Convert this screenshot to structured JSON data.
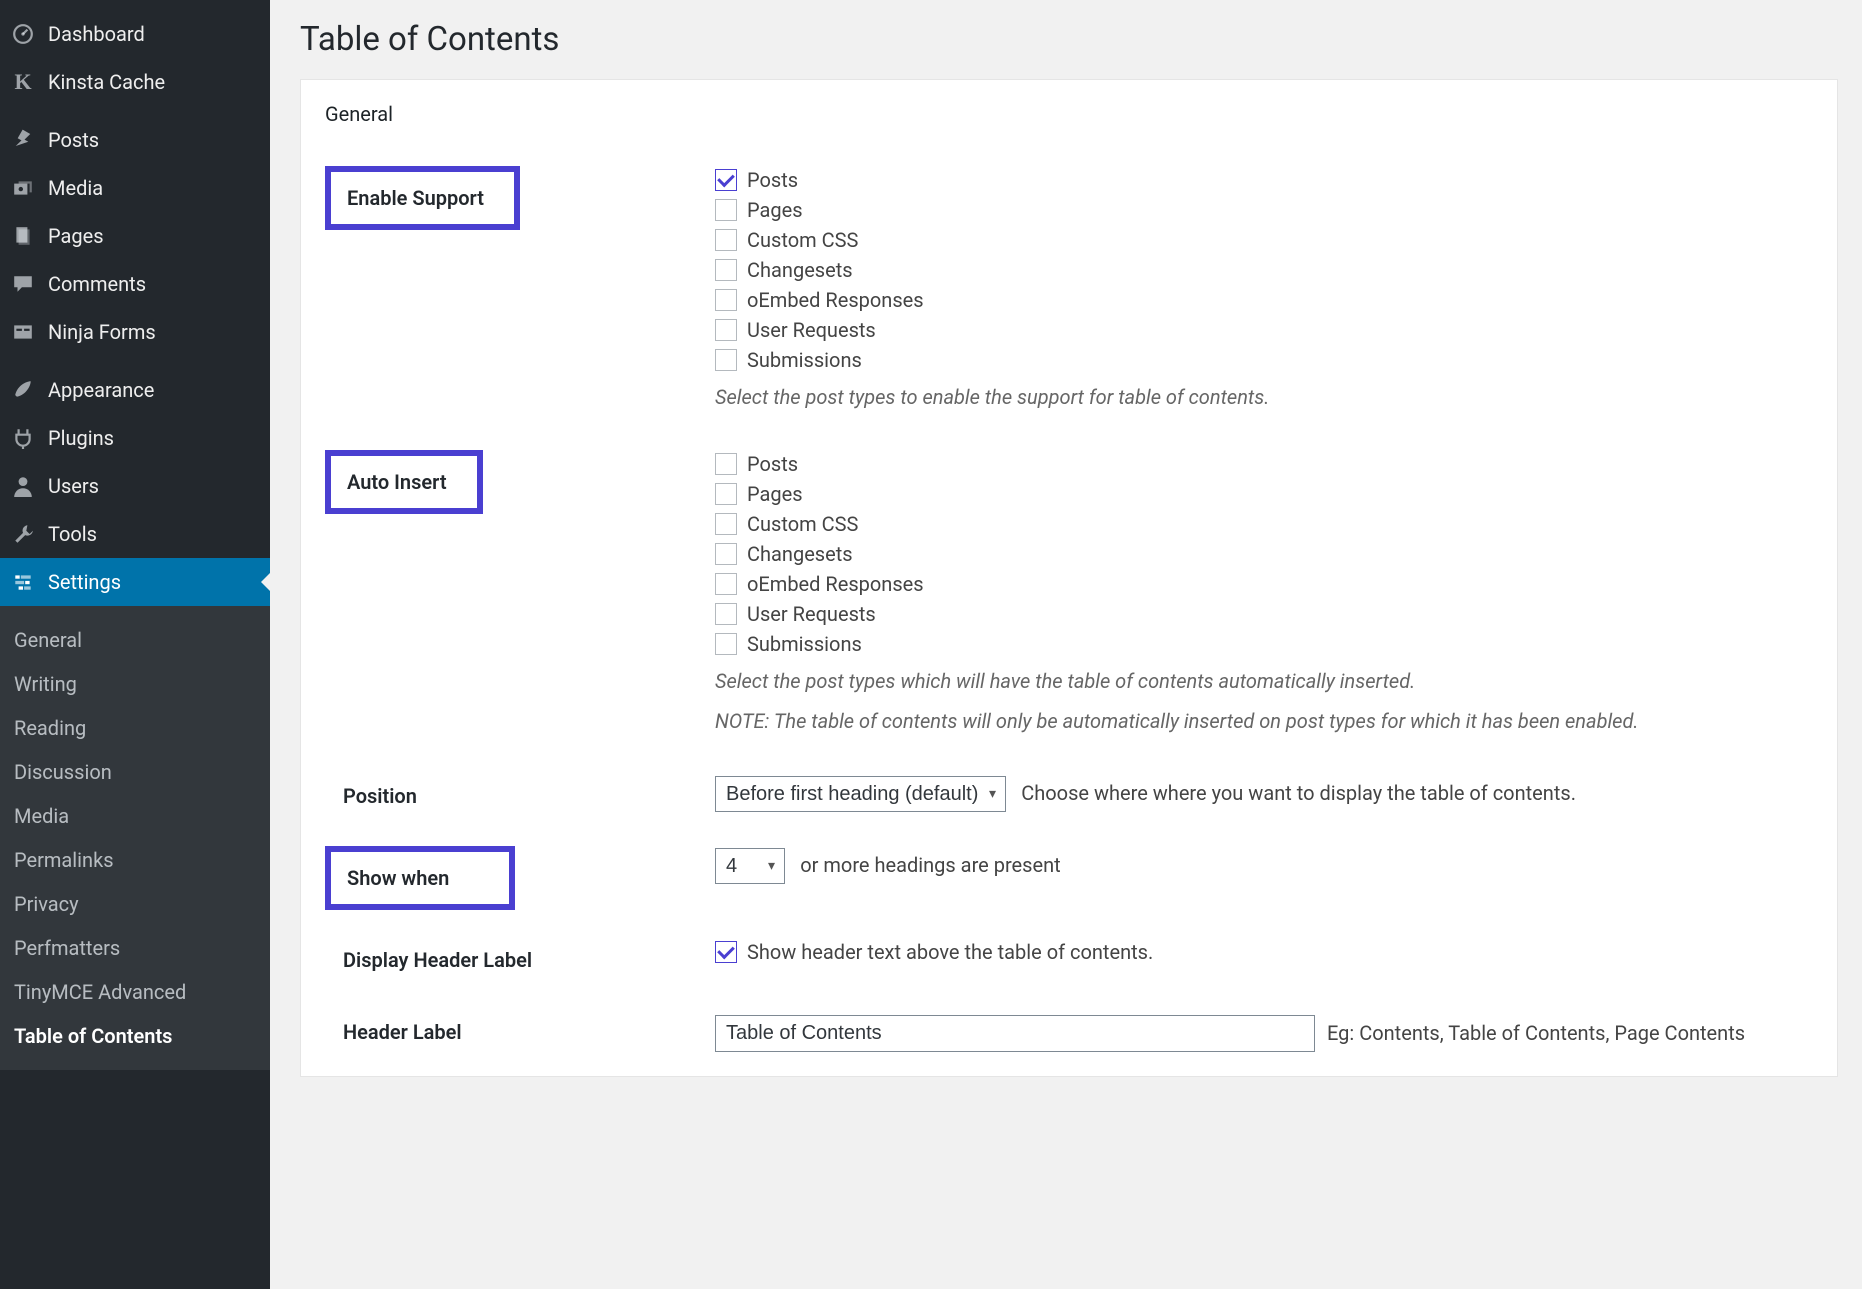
{
  "sidebar": {
    "items": [
      {
        "label": "Dashboard",
        "icon": "dashboard"
      },
      {
        "label": "Kinsta Cache",
        "icon": "kinsta"
      },
      {
        "label": "Posts",
        "icon": "pin"
      },
      {
        "label": "Media",
        "icon": "media"
      },
      {
        "label": "Pages",
        "icon": "pages"
      },
      {
        "label": "Comments",
        "icon": "comment"
      },
      {
        "label": "Ninja Forms",
        "icon": "ninja"
      },
      {
        "label": "Appearance",
        "icon": "brush"
      },
      {
        "label": "Plugins",
        "icon": "plug"
      },
      {
        "label": "Users",
        "icon": "user"
      },
      {
        "label": "Tools",
        "icon": "wrench"
      },
      {
        "label": "Settings",
        "icon": "settings",
        "active": true
      }
    ],
    "submenu": [
      "General",
      "Writing",
      "Reading",
      "Discussion",
      "Media",
      "Permalinks",
      "Privacy",
      "Perfmatters",
      "TinyMCE Advanced",
      "Table of Contents"
    ],
    "submenu_current": "Table of Contents"
  },
  "page": {
    "title": "Table of Contents"
  },
  "panel": {
    "tab": "General",
    "enable_support": {
      "label": "Enable Support",
      "options": [
        "Posts",
        "Pages",
        "Custom CSS",
        "Changesets",
        "oEmbed Responses",
        "User Requests",
        "Submissions"
      ],
      "checked": [
        "Posts"
      ],
      "desc": "Select the post types to enable the support for table of contents."
    },
    "auto_insert": {
      "label": "Auto Insert",
      "options": [
        "Posts",
        "Pages",
        "Custom CSS",
        "Changesets",
        "oEmbed Responses",
        "User Requests",
        "Submissions"
      ],
      "checked": [],
      "desc1": "Select the post types which will have the table of contents automatically inserted.",
      "desc2": "NOTE: The table of contents will only be automatically inserted on post types for which it has been enabled."
    },
    "position": {
      "label": "Position",
      "value": "Before first heading (default)",
      "after": "Choose where where you want to display the table of contents."
    },
    "show_when": {
      "label": "Show when",
      "value": "4",
      "after": "or more headings are present"
    },
    "header_label_toggle": {
      "label": "Display Header Label",
      "checked": true,
      "text": "Show header text above the table of contents."
    },
    "header_label_input": {
      "label": "Header Label",
      "value": "Table of Contents",
      "eg": "Eg: Contents, Table of Contents, Page Contents"
    }
  }
}
